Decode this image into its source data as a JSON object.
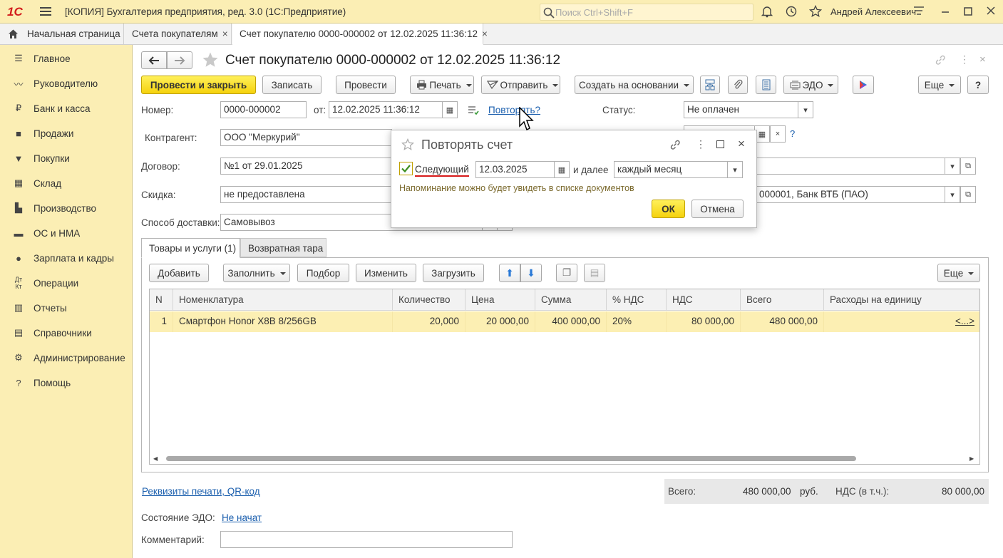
{
  "titlebar": {
    "logo": "1С",
    "title": "[КОПИЯ] Бухгалтерия предприятия, ред. 3.0  (1С:Предприятие)",
    "search_placeholder": "Поиск Ctrl+Shift+F",
    "user": "Андрей Алексеевич"
  },
  "tabs": [
    {
      "label": "Начальная страница"
    },
    {
      "label": "Счета покупателям"
    },
    {
      "label": "Счет покупателю 0000-000002 от 12.02.2025 11:36:12"
    }
  ],
  "sidebar": {
    "items": [
      {
        "label": "Главное",
        "icon": "menu-icon"
      },
      {
        "label": "Руководителю",
        "icon": "chart-line-icon"
      },
      {
        "label": "Банк и касса",
        "icon": "ruble-icon"
      },
      {
        "label": "Продажи",
        "icon": "bag-icon"
      },
      {
        "label": "Покупки",
        "icon": "cart-icon"
      },
      {
        "label": "Склад",
        "icon": "warehouse-icon"
      },
      {
        "label": "Производство",
        "icon": "factory-icon"
      },
      {
        "label": "ОС и НМА",
        "icon": "truck-icon"
      },
      {
        "label": "Зарплата и кадры",
        "icon": "person-icon"
      },
      {
        "label": "Операции",
        "icon": "dt-kt-icon"
      },
      {
        "label": "Отчеты",
        "icon": "report-icon"
      },
      {
        "label": "Справочники",
        "icon": "books-icon"
      },
      {
        "label": "Администрирование",
        "icon": "gear-icon"
      },
      {
        "label": "Помощь",
        "icon": "question-icon"
      }
    ]
  },
  "document": {
    "title": "Счет покупателю 0000-000002 от 12.02.2025 11:36:12"
  },
  "toolbar": {
    "post_close": "Провести и закрыть",
    "save": "Записать",
    "post": "Провести",
    "print": "Печать",
    "send": "Отправить",
    "create_based": "Создать на основании",
    "edo": "ЭДО",
    "more": "Еще",
    "help": "?"
  },
  "form": {
    "number_label": "Номер:",
    "number": "0000-000002",
    "from_label": "от:",
    "date": "12.02.2025 11:36:12",
    "repeat_link": "Повторять?",
    "status_label": "Статус:",
    "status": "Не оплачен",
    "counterparty_label": "Контрагент:",
    "counterparty": "ООО \"Меркурий\"",
    "contract_label": "Договор:",
    "contract": "№1 от 29.01.2025",
    "discount_label": "Скидка:",
    "discount": "не предоставлена",
    "bank_account": "000001, Банк ВТБ (ПАО)",
    "delivery_label": "Способ доставки:",
    "delivery": "Самовывоз"
  },
  "section_tabs": [
    "Товары и услуги (1)",
    "Возвратная тара"
  ],
  "grid_toolbar": {
    "add": "Добавить",
    "fill": "Заполнить",
    "pick": "Подбор",
    "change": "Изменить",
    "load": "Загрузить",
    "more": "Еще"
  },
  "grid": {
    "columns": [
      "N",
      "Номенклатура",
      "Количество",
      "Цена",
      "Сумма",
      "% НДС",
      "НДС",
      "Всего",
      "Расходы на единицу"
    ],
    "rows": [
      [
        "1",
        "Смартфон Honor X8B 8/256GB",
        "20,000",
        "20 000,00",
        "400 000,00",
        "20%",
        "80 000,00",
        "480 000,00",
        "<...>"
      ]
    ]
  },
  "footer": {
    "print_details_link": "Реквизиты печати, QR-код",
    "total_label": "Всего:",
    "total": "480 000,00",
    "currency": "руб.",
    "vat_label": "НДС (в т.ч.):",
    "vat": "80 000,00",
    "edo_state_label": "Состояние ЭДО:",
    "edo_state": "Не начат",
    "comment_label": "Комментарий:",
    "comment": ""
  },
  "dialog": {
    "title": "Повторять счет",
    "next_label": "Следующий",
    "next_checked": true,
    "next_date": "12.03.2025",
    "then_label": "и далее",
    "period": "каждый месяц",
    "hint": "Напоминание можно будет увидеть в списке документов",
    "ok": "ОК",
    "cancel": "Отмена"
  }
}
